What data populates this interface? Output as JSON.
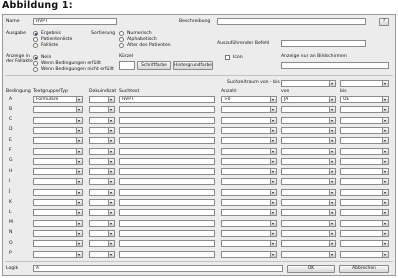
{
  "caption": "Abbildung 1:",
  "form": {
    "name_label": "Name",
    "name_value": "HVPT",
    "beschreibung_label": "Beschreibung",
    "beschreibung_value": "",
    "help_label": "?",
    "ausgabe_label": "Ausgabe",
    "ausgabe_options": [
      "Ergebnis",
      "Patientenliste",
      "Fallliste"
    ],
    "ausgabe_selected": 0,
    "sortierung_label": "Sortierung",
    "sortierung_options": [
      "Numerisch",
      "Alphabetisch",
      "Alter des Patienten"
    ],
    "sortierung_selected": -1,
    "auszufuehrender_befehl_label": "Auszuführender Befehl",
    "auszufuehrender_befehl_value": "",
    "anzeige_label_1": "Anzeige in",
    "anzeige_label_2": "der Fallakte",
    "anzeige_options": [
      "Nein",
      "Wenn Bedingungen erfüllt",
      "Wenn Bedingungen nicht erfüllt"
    ],
    "anzeige_selected": 0,
    "kuerzel_label": "Kürzel",
    "kuerzel_value": "",
    "schriftfarbe_label": "Schriftfarbe",
    "hintergrundfarbe_label": "Hintergrundfarbe",
    "icon_label": "Icon",
    "icon_checked": false,
    "bildschirmen_label": "Anzeige nur an Bildschirmen",
    "bildschirmen_value": "",
    "suchzeitraum_label": "Suchzeitraum von - bis",
    "suchzeitraum_von": "",
    "suchzeitraum_bis": ""
  },
  "table": {
    "headers": {
      "bedingung": "Bedingung",
      "textgruppe": "Textgruppe/Typ",
      "doku": "Dokuindizat",
      "suchtext": "Suchtext",
      "anzahl": "Anzahl",
      "von": "von",
      "bis": "bis"
    },
    "rows": [
      {
        "letter": "A",
        "textgruppe": "Formulare",
        "doku": "",
        "suchtext": "HVPT",
        "anzahl": ">0",
        "von": "JA",
        "bis": "OE"
      },
      {
        "letter": "B",
        "textgruppe": "",
        "doku": "",
        "suchtext": "",
        "anzahl": "",
        "von": "",
        "bis": ""
      },
      {
        "letter": "C",
        "textgruppe": "",
        "doku": "",
        "suchtext": "",
        "anzahl": "",
        "von": "",
        "bis": ""
      },
      {
        "letter": "D",
        "textgruppe": "",
        "doku": "",
        "suchtext": "",
        "anzahl": "",
        "von": "",
        "bis": ""
      },
      {
        "letter": "E",
        "textgruppe": "",
        "doku": "",
        "suchtext": "",
        "anzahl": "",
        "von": "",
        "bis": ""
      },
      {
        "letter": "F",
        "textgruppe": "",
        "doku": "",
        "suchtext": "",
        "anzahl": "",
        "von": "",
        "bis": ""
      },
      {
        "letter": "G",
        "textgruppe": "",
        "doku": "",
        "suchtext": "",
        "anzahl": "",
        "von": "",
        "bis": ""
      },
      {
        "letter": "H",
        "textgruppe": "",
        "doku": "",
        "suchtext": "",
        "anzahl": "",
        "von": "",
        "bis": ""
      },
      {
        "letter": "I",
        "textgruppe": "",
        "doku": "",
        "suchtext": "",
        "anzahl": "",
        "von": "",
        "bis": ""
      },
      {
        "letter": "J",
        "textgruppe": "",
        "doku": "",
        "suchtext": "",
        "anzahl": "",
        "von": "",
        "bis": ""
      },
      {
        "letter": "K",
        "textgruppe": "",
        "doku": "",
        "suchtext": "",
        "anzahl": "",
        "von": "",
        "bis": ""
      },
      {
        "letter": "L",
        "textgruppe": "",
        "doku": "",
        "suchtext": "",
        "anzahl": "",
        "von": "",
        "bis": ""
      },
      {
        "letter": "M",
        "textgruppe": "",
        "doku": "",
        "suchtext": "",
        "anzahl": "",
        "von": "",
        "bis": ""
      },
      {
        "letter": "N",
        "textgruppe": "",
        "doku": "",
        "suchtext": "",
        "anzahl": "",
        "von": "",
        "bis": ""
      },
      {
        "letter": "O",
        "textgruppe": "",
        "doku": "",
        "suchtext": "",
        "anzahl": "",
        "von": "",
        "bis": ""
      },
      {
        "letter": "P",
        "textgruppe": "",
        "doku": "",
        "suchtext": "",
        "anzahl": "",
        "von": "",
        "bis": ""
      }
    ]
  },
  "footer": {
    "logik_label": "Logik",
    "logik_value": "A",
    "ok_label": "OK",
    "abbrechen_label": "Abbrechen"
  },
  "colors": {
    "window_bg": "#ececec",
    "radio_selected": "#1e3f9e"
  }
}
